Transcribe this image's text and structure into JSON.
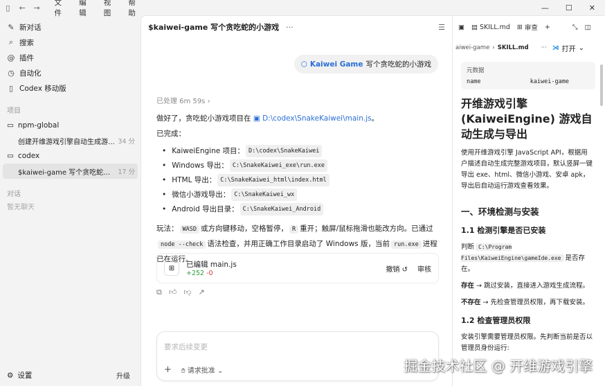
{
  "menu": [
    "文件",
    "编辑",
    "视图",
    "帮助"
  ],
  "sidebar": {
    "nav": [
      {
        "label": "新对话",
        "icon": "edit-icon"
      },
      {
        "label": "搜索",
        "icon": "search-icon"
      },
      {
        "label": "插件",
        "icon": "plugin-icon"
      },
      {
        "label": "自动化",
        "icon": "clock-icon"
      },
      {
        "label": "Codex 移动版",
        "icon": "phone-icon"
      }
    ],
    "projects_title": "项目",
    "folders": [
      {
        "name": "npm-global",
        "threads": [
          {
            "title": "创建开维游戏引擎自动生成游戏 ...",
            "time": "34 分"
          }
        ]
      },
      {
        "name": "codex",
        "threads": [
          {
            "title": "$kaiwei-game 写个贪吃蛇的小...",
            "time": "17 分"
          }
        ]
      }
    ],
    "chats_title": "对话",
    "chats_empty": "暂无聊天",
    "settings": "设置",
    "upgrade": "升级"
  },
  "main": {
    "title": "$kaiwei-game 写个贪吃蛇的小游戏",
    "user_tag": "Kaiwei Game",
    "user_msg": "写个贪吃蛇的小游戏",
    "processed": "已处理 6m 59s",
    "intro": "做好了，贪吃蛇小游戏项目在",
    "intro_path": "D:\\codex\\SnakeKaiwei\\main.js",
    "intro_end": "。",
    "done_label": "已完成：",
    "items": [
      {
        "label": "KaiweiEngine 项目：",
        "code": "D:\\codex\\SnakeKaiwei"
      },
      {
        "label": "Windows 导出：",
        "code": "C:\\SnakeKaiwei_exe\\run.exe"
      },
      {
        "label": "HTML 导出：",
        "code": "C:\\SnakeKaiwei_html\\index.html"
      },
      {
        "label": "微信小游戏导出：",
        "code": "C:\\SnakeKaiwei_wx"
      },
      {
        "label": "Android 导出目录：",
        "code": "C:\\SnakeKaiwei_Android"
      }
    ],
    "play_1": "玩法：",
    "play_code_1": "WASD",
    "play_2": "或方向键移动，空格暂停，",
    "play_code_2": "R",
    "play_3": "重开；触屏/鼠标拖滑也能改方向。已通过",
    "play_code_3": "node --check",
    "play_4": "语法检查，并用正确工作目录启动了 Windows 版，当前",
    "play_code_4": "run.exe",
    "play_5": "进程已在运行。",
    "edit_title": "已编辑 main.js",
    "edit_add": "+252",
    "edit_del": "-0",
    "undo": "撤销 ↺",
    "review": "审核",
    "composer_placeholder": "要求后续变更",
    "request_approval": "请求批准"
  },
  "right": {
    "tab1": "SKILL.md",
    "tab2": "审查",
    "crumb_parent": "aiwei-game",
    "crumb_current": "SKILL.md",
    "open": "打开",
    "meta_label": "元数据",
    "meta_key": "name",
    "meta_val": "kaiwei-game",
    "h1": "开维游戏引擎 (KaiweiEngine) 游戏自动生成与导出",
    "p1": "使用开维游戏引擎 JavaScript API，根据用户描述自动生成完整游戏项目，默认竖屏一键导出 exe、html、微信小游戏、安卓 apk，导出后自动运行游戏查看效果。",
    "h2": "一、环境检测与安装",
    "h3a": "1.1 检测引擎是否已安装",
    "judge": "判断",
    "judge_code": "C:\\Program Files\\KaiweiEngine\\gameIde.exe",
    "judge_end": "是否存在。",
    "exists_b": "存在",
    "exists_t": " → 跳过安装，直接进入游戏生成流程。",
    "notexists_b": "不存在",
    "notexists_t": " → 先检查管理员权限，再下载安装。",
    "h3b": "1.2 检查管理员权限",
    "p2": "安装引擎需要管理员权限。先判断当前是否以管理员身份运行:"
  },
  "watermark": "掘金技术社区 @ 开维游戏引擎"
}
